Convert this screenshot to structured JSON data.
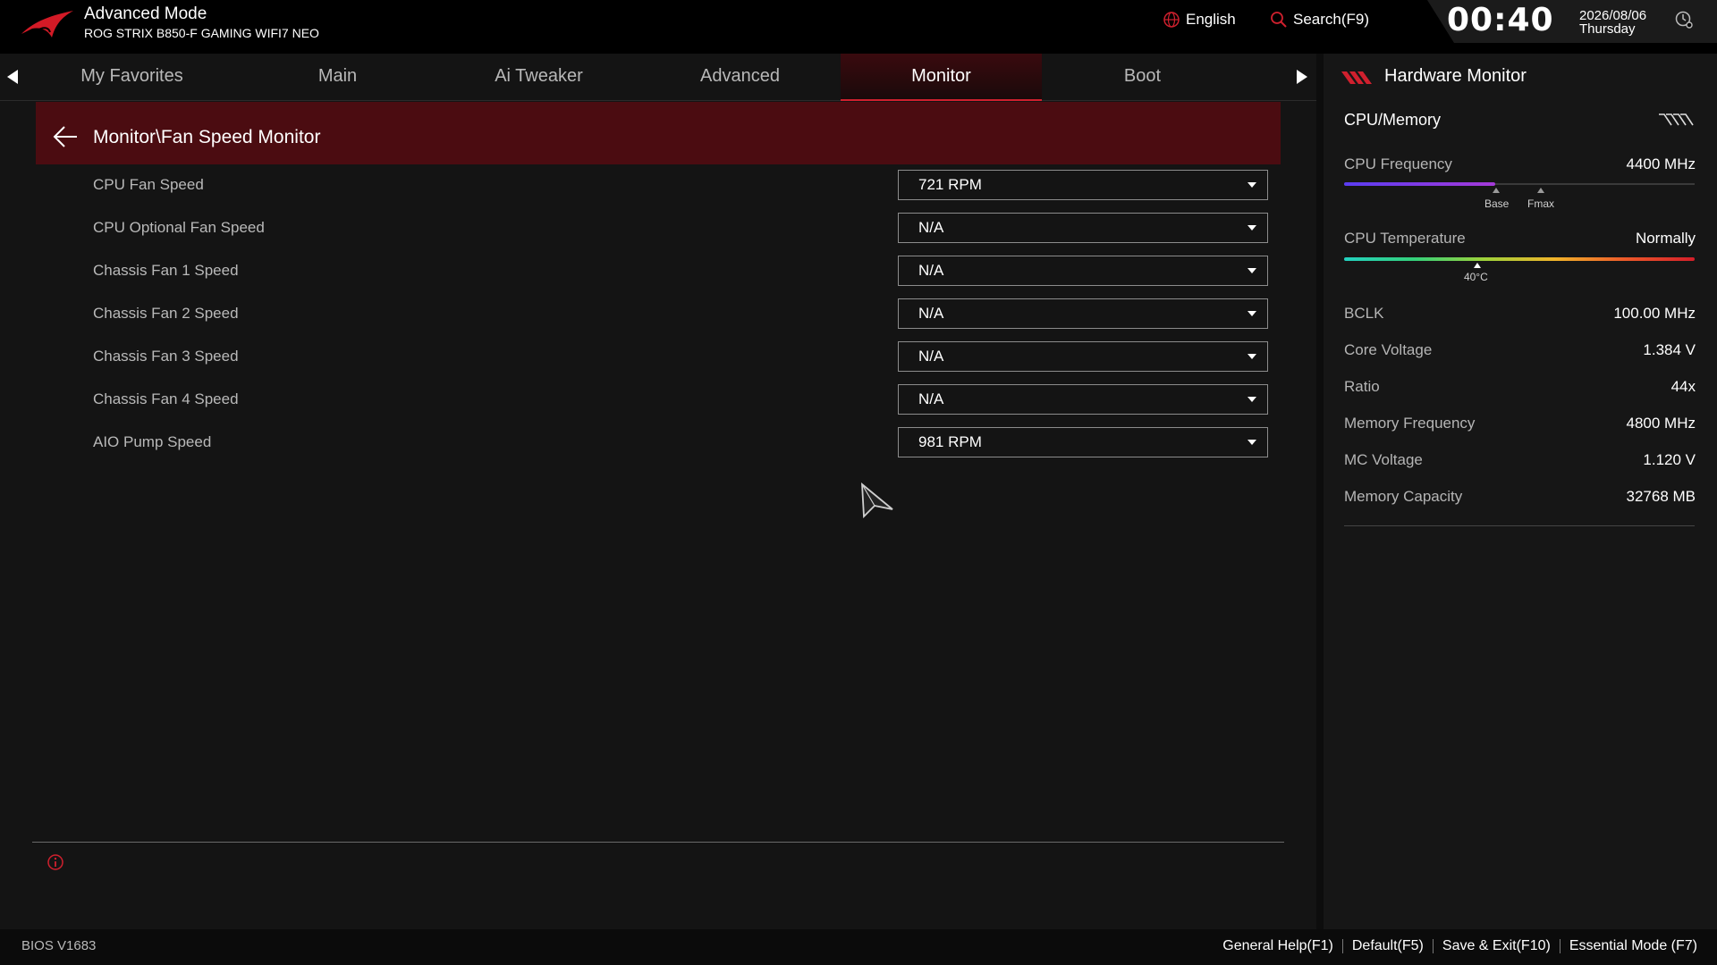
{
  "header": {
    "mode": "Advanced Mode",
    "board": "ROG STRIX B850-F GAMING WIFI7 NEO",
    "language": "English",
    "search": "Search(F9)",
    "time": "00:40",
    "date": "2026/08/06",
    "weekday": "Thursday"
  },
  "tabs": [
    "My Favorites",
    "Main",
    "Ai Tweaker",
    "Advanced",
    "Monitor",
    "Boot"
  ],
  "active_tab": "Monitor",
  "breadcrumb": "Monitor\\Fan Speed Monitor",
  "rows": [
    {
      "label": "CPU Fan Speed",
      "value": "721 RPM"
    },
    {
      "label": "CPU Optional Fan Speed",
      "value": "N/A"
    },
    {
      "label": "Chassis Fan 1 Speed",
      "value": "N/A"
    },
    {
      "label": "Chassis Fan 2 Speed",
      "value": "N/A"
    },
    {
      "label": "Chassis Fan 3 Speed",
      "value": "N/A"
    },
    {
      "label": "Chassis Fan 4 Speed",
      "value": "N/A"
    },
    {
      "label": "AIO Pump Speed",
      "value": "981 RPM"
    }
  ],
  "hw_monitor": {
    "title": "Hardware Monitor",
    "section": "CPU/Memory",
    "cpu_frequency": {
      "label": "CPU Frequency",
      "value": "4400 MHz",
      "fill_fraction": 0.43,
      "base_label": "Base",
      "fmax_label": "Fmax"
    },
    "cpu_temperature": {
      "label": "CPU Temperature",
      "value": "Normally",
      "marker_label": "40°C",
      "marker_fraction": 0.38
    },
    "items": [
      {
        "label": "BCLK",
        "value": "100.00 MHz"
      },
      {
        "label": "Core Voltage",
        "value": "1.384 V"
      },
      {
        "label": "Ratio",
        "value": "44x"
      },
      {
        "label": "Memory Frequency",
        "value": "4800 MHz"
      },
      {
        "label": "MC Voltage",
        "value": "1.120 V"
      },
      {
        "label": "Memory Capacity",
        "value": "32768 MB"
      }
    ]
  },
  "footer": {
    "bios_version": "BIOS V1683",
    "links": [
      "General Help(F1)",
      "Default(F5)",
      "Save & Exit(F10)",
      "Essential Mode (F7)"
    ]
  },
  "colors": {
    "accent": "#d0202e",
    "breadcrumb_bg": "#4b0c11",
    "background": "#141414"
  },
  "icons": [
    "rog-logo-icon",
    "globe-icon",
    "search-icon",
    "clock-settings-icon",
    "left-arrow-icon",
    "right-arrow-icon",
    "back-arrow-icon",
    "chevron-down-icon",
    "cursor-icon",
    "info-icon",
    "stripes-icon",
    "wave-icon"
  ]
}
